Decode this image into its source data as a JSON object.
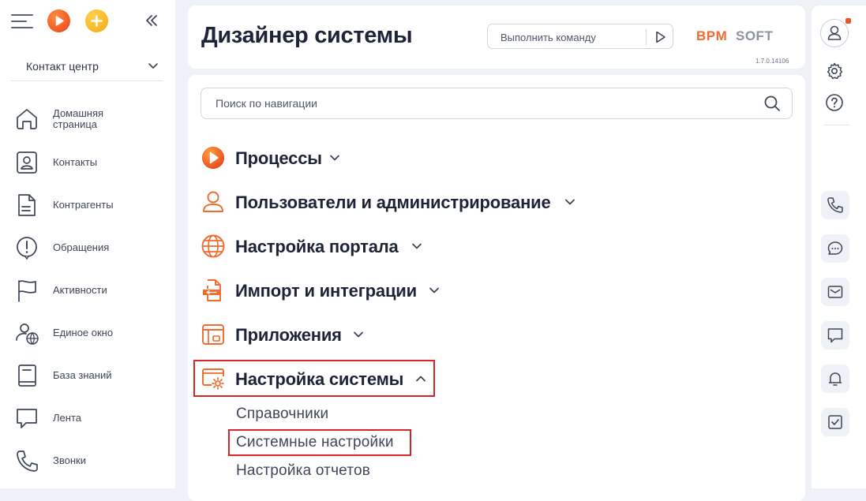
{
  "sidebar": {
    "workspace": "Контакт центр",
    "items": [
      {
        "label": "Домашняя\nстраница",
        "icon": "home-icon"
      },
      {
        "label": "Контакты",
        "icon": "contact-card-icon"
      },
      {
        "label": "Контрагенты",
        "icon": "document-icon"
      },
      {
        "label": "Обращения",
        "icon": "alert-circle-icon"
      },
      {
        "label": "Активности",
        "icon": "flag-icon"
      },
      {
        "label": "Единое окно",
        "icon": "user-globe-icon"
      },
      {
        "label": "База знаний",
        "icon": "book-icon"
      },
      {
        "label": "Лента",
        "icon": "chat-bubble-icon"
      },
      {
        "label": "Звонки",
        "icon": "phone-icon"
      }
    ]
  },
  "header": {
    "title": "Дизайнер системы",
    "command_placeholder": "Выполнить команду",
    "logo_text": "BPMSOFT",
    "version": "1.7.0.14106"
  },
  "content": {
    "search_placeholder": "Поиск по навигации",
    "sections": [
      {
        "label": "Процессы",
        "icon": "process-play-icon",
        "expanded": false
      },
      {
        "label": "Пользователи и администрирование",
        "icon": "user-icon",
        "expanded": false
      },
      {
        "label": "Настройка портала",
        "icon": "globe-icon",
        "expanded": false
      },
      {
        "label": "Импорт и интеграции",
        "icon": "import-file-icon",
        "expanded": false
      },
      {
        "label": "Приложения",
        "icon": "app-window-icon",
        "expanded": false
      },
      {
        "label": "Настройка системы",
        "icon": "system-settings-icon",
        "expanded": true
      }
    ],
    "subitems": [
      "Справочники",
      "Системные настройки",
      "Настройка отчетов"
    ]
  },
  "colors": {
    "accent": "#f26a2e",
    "highlight": "#d8232a",
    "title": "#1d2438"
  }
}
